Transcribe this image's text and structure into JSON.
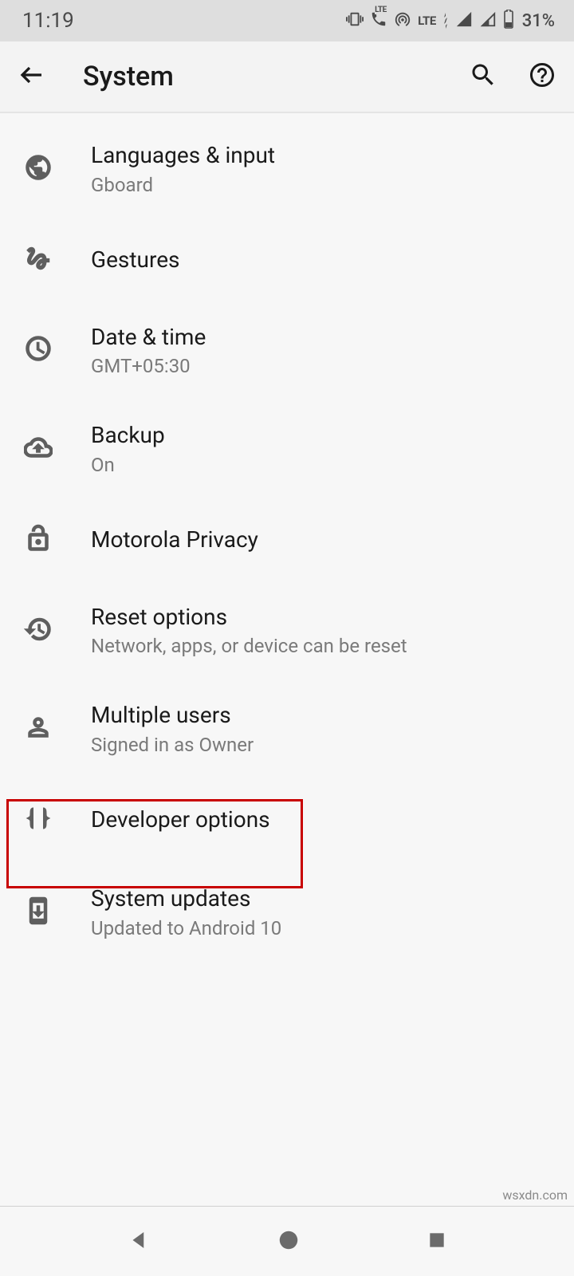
{
  "status": {
    "time": "11:19",
    "lte_label": "LTE",
    "lte_small": "LTE",
    "battery_text": "31%"
  },
  "header": {
    "title": "System"
  },
  "items": [
    {
      "icon": "globe",
      "title": "Languages & input",
      "subtitle": "Gboard"
    },
    {
      "icon": "gesture",
      "title": "Gestures",
      "subtitle": ""
    },
    {
      "icon": "clock",
      "title": "Date & time",
      "subtitle": "GMT+05:30"
    },
    {
      "icon": "cloud-upload",
      "title": "Backup",
      "subtitle": "On"
    },
    {
      "icon": "lock-open",
      "title": "Motorola Privacy",
      "subtitle": ""
    },
    {
      "icon": "restore",
      "title": "Reset options",
      "subtitle": "Network, apps, or device can be reset"
    },
    {
      "icon": "person",
      "title": "Multiple users",
      "subtitle": "Signed in as Owner"
    },
    {
      "icon": "braces",
      "title": "Developer options",
      "subtitle": ""
    },
    {
      "icon": "system-update",
      "title": "System updates",
      "subtitle": "Updated to Android 10"
    }
  ],
  "watermark": "wsxdn.com"
}
